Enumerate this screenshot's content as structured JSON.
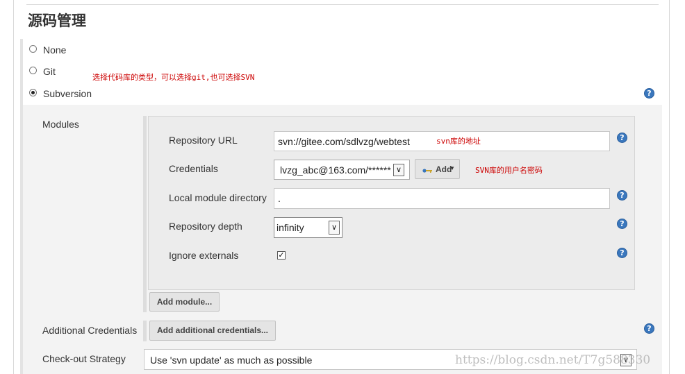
{
  "section": {
    "title": "源码管理"
  },
  "scm_options": [
    {
      "label": "None",
      "selected": false
    },
    {
      "label": "Git",
      "selected": false
    },
    {
      "label": "Subversion",
      "selected": true
    }
  ],
  "annotations": {
    "type_note": "选择代码库的类型，可以选择git,也可选择SVN",
    "url_note": "svn库的地址",
    "cred_note": "SVN库的用户名密码"
  },
  "modules": {
    "label": "Modules",
    "repository_url": {
      "label": "Repository URL",
      "value": "svn://gitee.com/sdlvzg/webtest"
    },
    "credentials": {
      "label": "Credentials",
      "value": "lvzg_abc@163.com/******",
      "add_button": "Add"
    },
    "local_module_directory": {
      "label": "Local module directory",
      "value": "."
    },
    "repository_depth": {
      "label": "Repository depth",
      "value": "infinity"
    },
    "ignore_externals": {
      "label": "Ignore externals",
      "checked": true
    },
    "add_module_button": "Add module..."
  },
  "additional_credentials": {
    "label": "Additional Credentials",
    "button": "Add additional credentials..."
  },
  "checkout_strategy": {
    "label": "Check-out Strategy",
    "value": "Use 'svn update' as much as possible"
  },
  "watermark": "https://blog.csdn.net/T7g588330",
  "help_glyph": "?",
  "colors": {
    "annotation": "#cc0000",
    "help_icon": "#3a77bd"
  }
}
